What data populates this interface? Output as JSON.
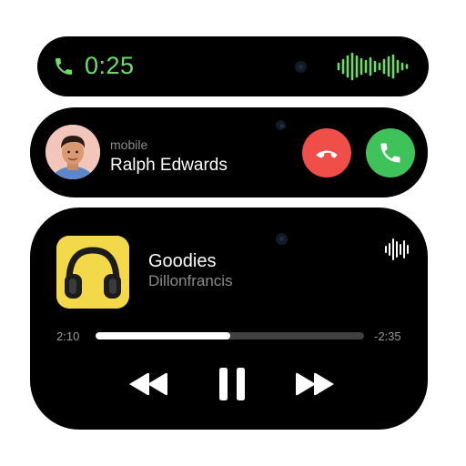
{
  "call": {
    "timer": "0:25",
    "icon": "phone-icon",
    "accent": "#6cdc6a"
  },
  "incoming": {
    "type_label": "mobile",
    "caller_name": "Ralph Edwards",
    "decline_icon": "phone-down-icon",
    "accept_icon": "phone-icon",
    "decline_color": "#ef4f48",
    "accept_color": "#3fc25a"
  },
  "player": {
    "title": "Goodies",
    "artist": "Dillonfrancis",
    "elapsed": "2:10",
    "remaining": "-2:35",
    "progress": 0.5,
    "art_icon": "headphones-icon",
    "art_color": "#f3d84a",
    "controls": [
      "rewind-icon",
      "pause-icon",
      "fast-forward-icon"
    ]
  }
}
